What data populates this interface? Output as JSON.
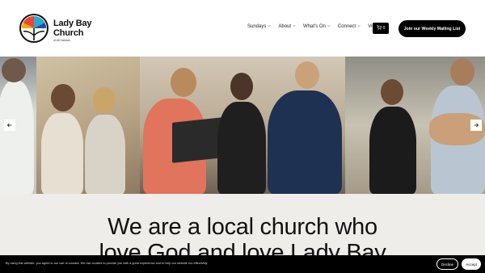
{
  "brand": {
    "name_line1": "Lady Bay",
    "name_line2": "Church",
    "tagline": "of All Hallows",
    "logo_colors": [
      "#e8463a",
      "#f2a900",
      "#2aa9c9",
      "#1f4e9c",
      "#111111"
    ]
  },
  "nav": {
    "items": [
      {
        "label": "Sundays",
        "dropdown": true
      },
      {
        "label": "About",
        "dropdown": true
      },
      {
        "label": "What's On",
        "dropdown": true
      },
      {
        "label": "Connect",
        "dropdown": true
      },
      {
        "label": "Visit",
        "dropdown": false
      }
    ]
  },
  "cart": {
    "count": "0",
    "icon": "cart-icon"
  },
  "cta": {
    "label": "Join our Weekly Mailing List"
  },
  "gallery": {
    "prev_icon": "arrow-left-icon",
    "next_icon": "arrow-right-icon"
  },
  "hero": {
    "line1": "We are a local church who",
    "line2": "love God and love Lady Bay"
  },
  "cookie": {
    "text": "By using this website, you agree to our use of cookies. We use cookies to provide you with a great experience and to help our website run effectively.",
    "decline": "Decline",
    "accept": "Accept"
  },
  "colors": {
    "header_bg": "#ffffff",
    "hero_bg": "#efedea",
    "button_bg": "#000000",
    "banner_bg": "#000000"
  }
}
